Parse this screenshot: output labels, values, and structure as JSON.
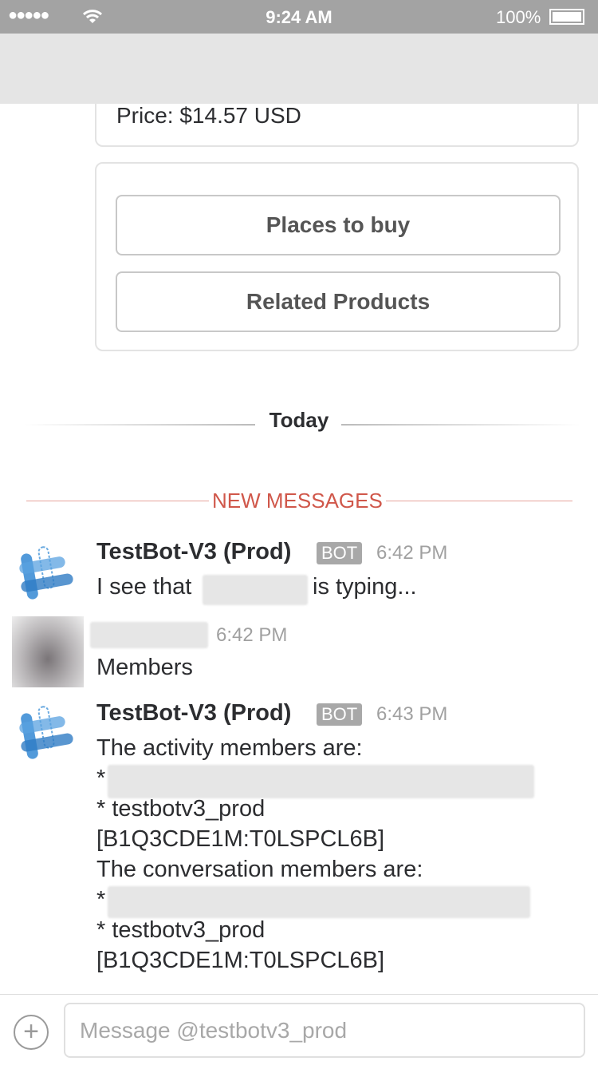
{
  "status_bar": {
    "signal": "●●●●●",
    "time": "9:24 AM",
    "battery": "100%"
  },
  "card": {
    "price": "Price: $14.57 USD",
    "buttons": [
      "Places to buy",
      "Related Products"
    ]
  },
  "dividers": {
    "today": "Today",
    "new_messages": "NEW MESSAGES"
  },
  "colors": {
    "new_messages": "#d0574a",
    "status_bar": "#a3a3a3"
  },
  "messages": [
    {
      "author": "TestBot-V3 (Prod)",
      "badge": "BOT",
      "time": "6:42 PM",
      "text_before": "I see that",
      "text_after": "is typing..."
    },
    {
      "time": "6:42 PM",
      "text": "Members"
    },
    {
      "author": "TestBot-V3 (Prod)",
      "badge": "BOT",
      "time": "6:43 PM",
      "lines": [
        "The activity members are:",
        "*",
        "* testbotv3_prod",
        "[B1Q3CDE1M:T0LSPCL6B]",
        "The conversation members are:",
        "*",
        "* testbotv3_prod",
        "[B1Q3CDE1M:T0LSPCL6B]"
      ]
    }
  ],
  "composer": {
    "placeholder": "Message @testbotv3_prod"
  }
}
